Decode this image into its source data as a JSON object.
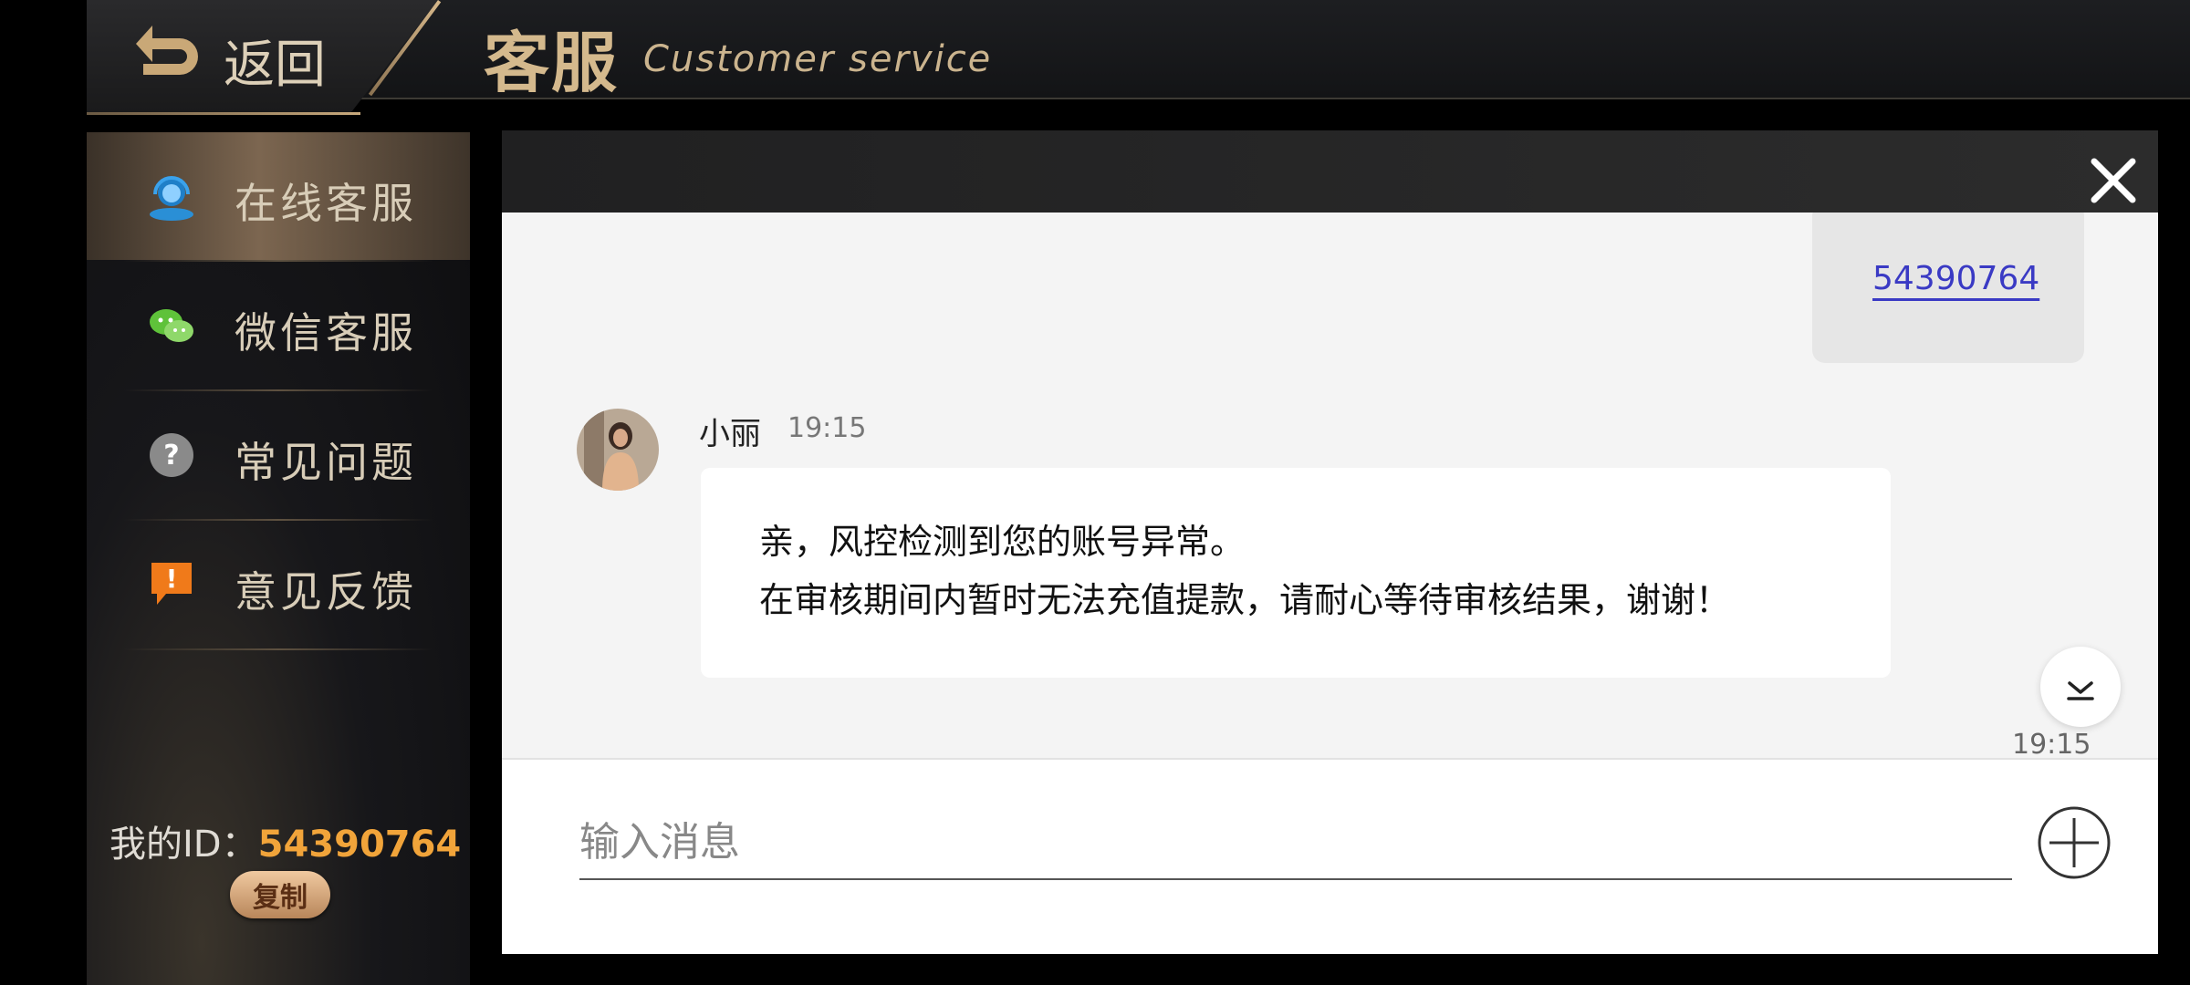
{
  "header": {
    "back_label": "返回",
    "title_cn": "客服",
    "title_en": "Customer service"
  },
  "sidebar": {
    "items": [
      {
        "label": "在线客服",
        "icon": "online-service-icon",
        "active": true
      },
      {
        "label": "微信客服",
        "icon": "wechat-icon",
        "active": false
      },
      {
        "label": "常见问题",
        "icon": "question-icon",
        "active": false
      },
      {
        "label": "意见反馈",
        "icon": "feedback-icon",
        "active": false
      }
    ],
    "my_id_label": "我的ID：",
    "my_id_value": "54390764",
    "copy_label": "复制"
  },
  "chat": {
    "sent_message": "54390764",
    "received": {
      "sender": "小丽",
      "time": "19:15",
      "lines": [
        "亲，风控检测到您的账号异常。",
        "在审核期间内暂时无法充值提款，请耐心等待审核结果，谢谢！"
      ]
    },
    "bottom_time": "19:15"
  },
  "input": {
    "placeholder": "输入消息"
  },
  "colors": {
    "accent_gold": "#d4b98d",
    "id_orange": "#f1a43a",
    "link_blue": "#3a3ac4"
  }
}
